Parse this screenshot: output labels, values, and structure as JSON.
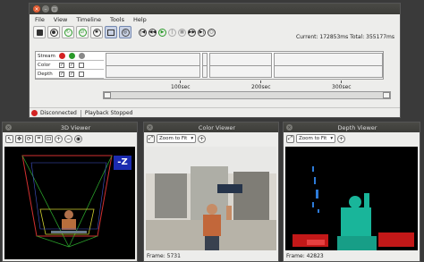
{
  "menu": [
    "File",
    "View",
    "Timeline",
    "Tools",
    "Help"
  ],
  "current_time": "Current: 172853ms Total: 355177ms",
  "streams": {
    "header": "Stream",
    "rows": [
      "Color",
      "Depth"
    ]
  },
  "timeline": {
    "ticks": [
      "100sec",
      "200sec",
      "300sec"
    ]
  },
  "status": {
    "connection": "Disconnected",
    "playback": "Playback Stopped"
  },
  "viewers": {
    "v3d": {
      "title": "3D Viewer",
      "depth_badge": "-Z"
    },
    "color": {
      "title": "Color Viewer",
      "zoom": "Zoom to Fit",
      "frame": "Frame: 5731"
    },
    "depth": {
      "title": "Depth Viewer",
      "zoom": "Zoom to Fit",
      "frame": "Frame: 42823"
    }
  },
  "colors": {
    "accent": "#e25d33",
    "record": "#d32222",
    "depth_fg": "#19b59a"
  }
}
